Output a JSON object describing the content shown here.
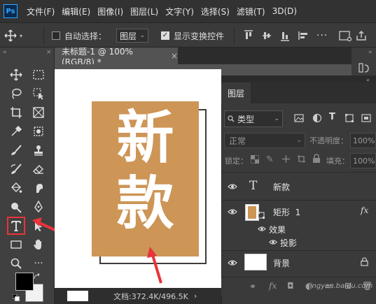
{
  "menu": {
    "logo": "Ps",
    "items": [
      "文件(F)",
      "编辑(E)",
      "图像(I)",
      "图层(L)",
      "文字(Y)",
      "选择(S)",
      "滤镜(T)",
      "3D(D)"
    ]
  },
  "options": {
    "auto_select_label": "自动选择：",
    "auto_select_value": "图层",
    "show_transform_label": "显示变换控件"
  },
  "document": {
    "tab_title": "未标题-1 @ 100%(RGB/8) *",
    "tab_close": "×",
    "text_line1": "新",
    "text_line2": "款",
    "status": "文档:372.4K/496.5K",
    "art_color": "#cd9556"
  },
  "layers_panel": {
    "title": "图层",
    "filter_kind": "类型",
    "blend_mode": "正常",
    "opacity_label": "不透明度：",
    "opacity_value": "100%",
    "lock_label": "锁定：",
    "fill_label": "填充：",
    "fill_value": "100%",
    "layers": [
      {
        "name": "新款",
        "type": "text",
        "thumb": "T"
      },
      {
        "name": "矩形  1",
        "type": "shape",
        "fx": "fx"
      },
      {
        "name": "效果",
        "type": "effect-group"
      },
      {
        "name": "投影",
        "type": "effect"
      },
      {
        "name": "背景",
        "type": "background"
      }
    ]
  },
  "watermark": "jingyan.baidu.com"
}
